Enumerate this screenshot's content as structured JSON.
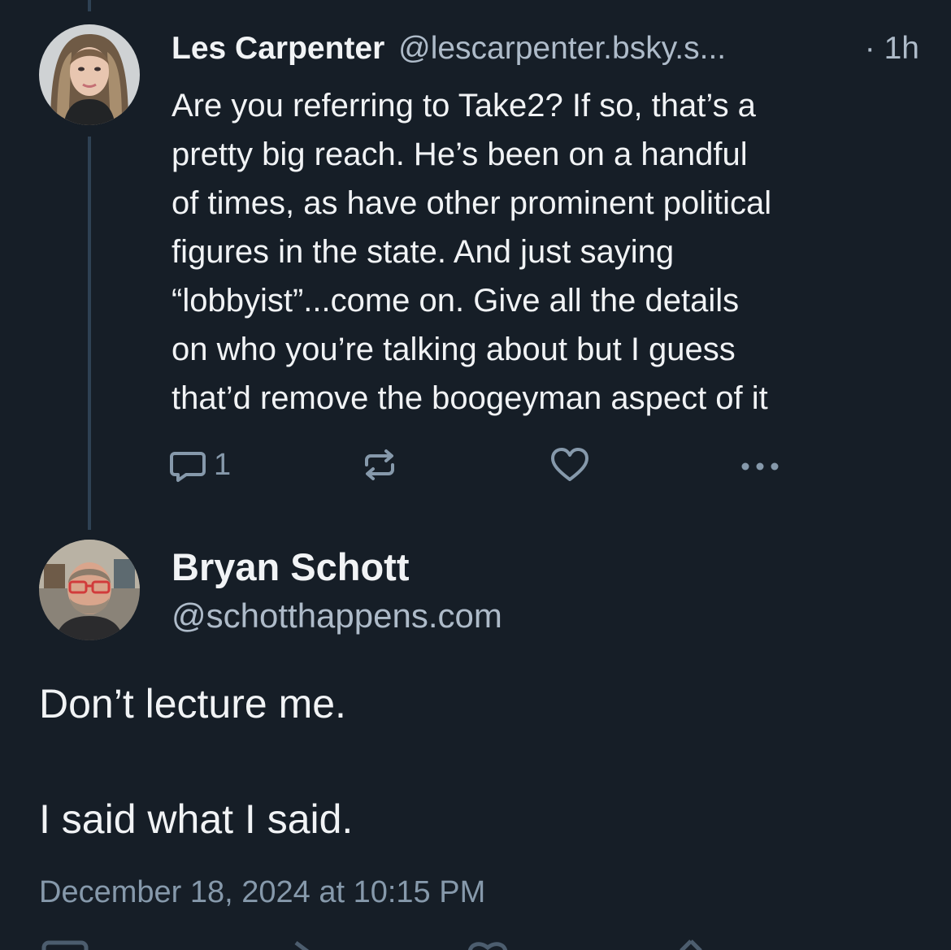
{
  "reply": {
    "author_name": "Les Carpenter",
    "author_handle": "@lescarpenter.bsky.s...",
    "time": "· 1h",
    "body_lines": [
      "Are you referring to Take2? If so, that’s a",
      "pretty big reach. He’s been on a handful",
      "of times, as have other prominent political",
      "figures in the state. And just saying",
      "“lobbyist”...come on. Give all the details",
      "on who you’re talking about but I guess",
      "that’d remove the boogeyman aspect of it"
    ],
    "reply_count": "1",
    "icons": {
      "reply": "speech-bubble-icon",
      "repost": "repost-icon",
      "like": "heart-icon",
      "more": "more-dots-icon"
    }
  },
  "post": {
    "author_name": "Bryan Schott",
    "author_handle": "@schotthappens.com",
    "body_paragraphs": [
      "Don’t lecture me.",
      "I said what I said."
    ],
    "timestamp": "December 18, 2024 at 10:15 PM"
  },
  "colors": {
    "background": "#161e27",
    "primary_text": "#f1f3f5",
    "secondary_text": "#aebbc9",
    "muted_text": "#8699ab",
    "thread_line": "#2e4153"
  }
}
